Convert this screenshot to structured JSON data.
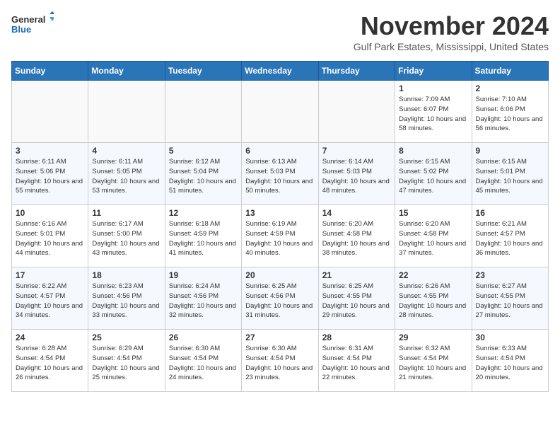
{
  "header": {
    "logo_line1": "General",
    "logo_line2": "Blue",
    "month": "November 2024",
    "location": "Gulf Park Estates, Mississippi, United States"
  },
  "weekdays": [
    "Sunday",
    "Monday",
    "Tuesday",
    "Wednesday",
    "Thursday",
    "Friday",
    "Saturday"
  ],
  "weeks": [
    [
      {
        "day": "",
        "empty": true
      },
      {
        "day": "",
        "empty": true
      },
      {
        "day": "",
        "empty": true
      },
      {
        "day": "",
        "empty": true
      },
      {
        "day": "",
        "empty": true
      },
      {
        "day": "1",
        "sunrise": "7:09 AM",
        "sunset": "6:07 PM",
        "daylight": "10 hours and 58 minutes."
      },
      {
        "day": "2",
        "sunrise": "7:10 AM",
        "sunset": "6:06 PM",
        "daylight": "10 hours and 56 minutes."
      }
    ],
    [
      {
        "day": "3",
        "sunrise": "6:11 AM",
        "sunset": "5:06 PM",
        "daylight": "10 hours and 55 minutes."
      },
      {
        "day": "4",
        "sunrise": "6:11 AM",
        "sunset": "5:05 PM",
        "daylight": "10 hours and 53 minutes."
      },
      {
        "day": "5",
        "sunrise": "6:12 AM",
        "sunset": "5:04 PM",
        "daylight": "10 hours and 51 minutes."
      },
      {
        "day": "6",
        "sunrise": "6:13 AM",
        "sunset": "5:03 PM",
        "daylight": "10 hours and 50 minutes."
      },
      {
        "day": "7",
        "sunrise": "6:14 AM",
        "sunset": "5:03 PM",
        "daylight": "10 hours and 48 minutes."
      },
      {
        "day": "8",
        "sunrise": "6:15 AM",
        "sunset": "5:02 PM",
        "daylight": "10 hours and 47 minutes."
      },
      {
        "day": "9",
        "sunrise": "6:15 AM",
        "sunset": "5:01 PM",
        "daylight": "10 hours and 45 minutes."
      }
    ],
    [
      {
        "day": "10",
        "sunrise": "6:16 AM",
        "sunset": "5:01 PM",
        "daylight": "10 hours and 44 minutes."
      },
      {
        "day": "11",
        "sunrise": "6:17 AM",
        "sunset": "5:00 PM",
        "daylight": "10 hours and 43 minutes."
      },
      {
        "day": "12",
        "sunrise": "6:18 AM",
        "sunset": "4:59 PM",
        "daylight": "10 hours and 41 minutes."
      },
      {
        "day": "13",
        "sunrise": "6:19 AM",
        "sunset": "4:59 PM",
        "daylight": "10 hours and 40 minutes."
      },
      {
        "day": "14",
        "sunrise": "6:20 AM",
        "sunset": "4:58 PM",
        "daylight": "10 hours and 38 minutes."
      },
      {
        "day": "15",
        "sunrise": "6:20 AM",
        "sunset": "4:58 PM",
        "daylight": "10 hours and 37 minutes."
      },
      {
        "day": "16",
        "sunrise": "6:21 AM",
        "sunset": "4:57 PM",
        "daylight": "10 hours and 36 minutes."
      }
    ],
    [
      {
        "day": "17",
        "sunrise": "6:22 AM",
        "sunset": "4:57 PM",
        "daylight": "10 hours and 34 minutes."
      },
      {
        "day": "18",
        "sunrise": "6:23 AM",
        "sunset": "4:56 PM",
        "daylight": "10 hours and 33 minutes."
      },
      {
        "day": "19",
        "sunrise": "6:24 AM",
        "sunset": "4:56 PM",
        "daylight": "10 hours and 32 minutes."
      },
      {
        "day": "20",
        "sunrise": "6:25 AM",
        "sunset": "4:56 PM",
        "daylight": "10 hours and 31 minutes."
      },
      {
        "day": "21",
        "sunrise": "6:25 AM",
        "sunset": "4:55 PM",
        "daylight": "10 hours and 29 minutes."
      },
      {
        "day": "22",
        "sunrise": "6:26 AM",
        "sunset": "4:55 PM",
        "daylight": "10 hours and 28 minutes."
      },
      {
        "day": "23",
        "sunrise": "6:27 AM",
        "sunset": "4:55 PM",
        "daylight": "10 hours and 27 minutes."
      }
    ],
    [
      {
        "day": "24",
        "sunrise": "6:28 AM",
        "sunset": "4:54 PM",
        "daylight": "10 hours and 26 minutes."
      },
      {
        "day": "25",
        "sunrise": "6:29 AM",
        "sunset": "4:54 PM",
        "daylight": "10 hours and 25 minutes."
      },
      {
        "day": "26",
        "sunrise": "6:30 AM",
        "sunset": "4:54 PM",
        "daylight": "10 hours and 24 minutes."
      },
      {
        "day": "27",
        "sunrise": "6:30 AM",
        "sunset": "4:54 PM",
        "daylight": "10 hours and 23 minutes."
      },
      {
        "day": "28",
        "sunrise": "6:31 AM",
        "sunset": "4:54 PM",
        "daylight": "10 hours and 22 minutes."
      },
      {
        "day": "29",
        "sunrise": "6:32 AM",
        "sunset": "4:54 PM",
        "daylight": "10 hours and 21 minutes."
      },
      {
        "day": "30",
        "sunrise": "6:33 AM",
        "sunset": "4:54 PM",
        "daylight": "10 hours and 20 minutes."
      }
    ]
  ]
}
